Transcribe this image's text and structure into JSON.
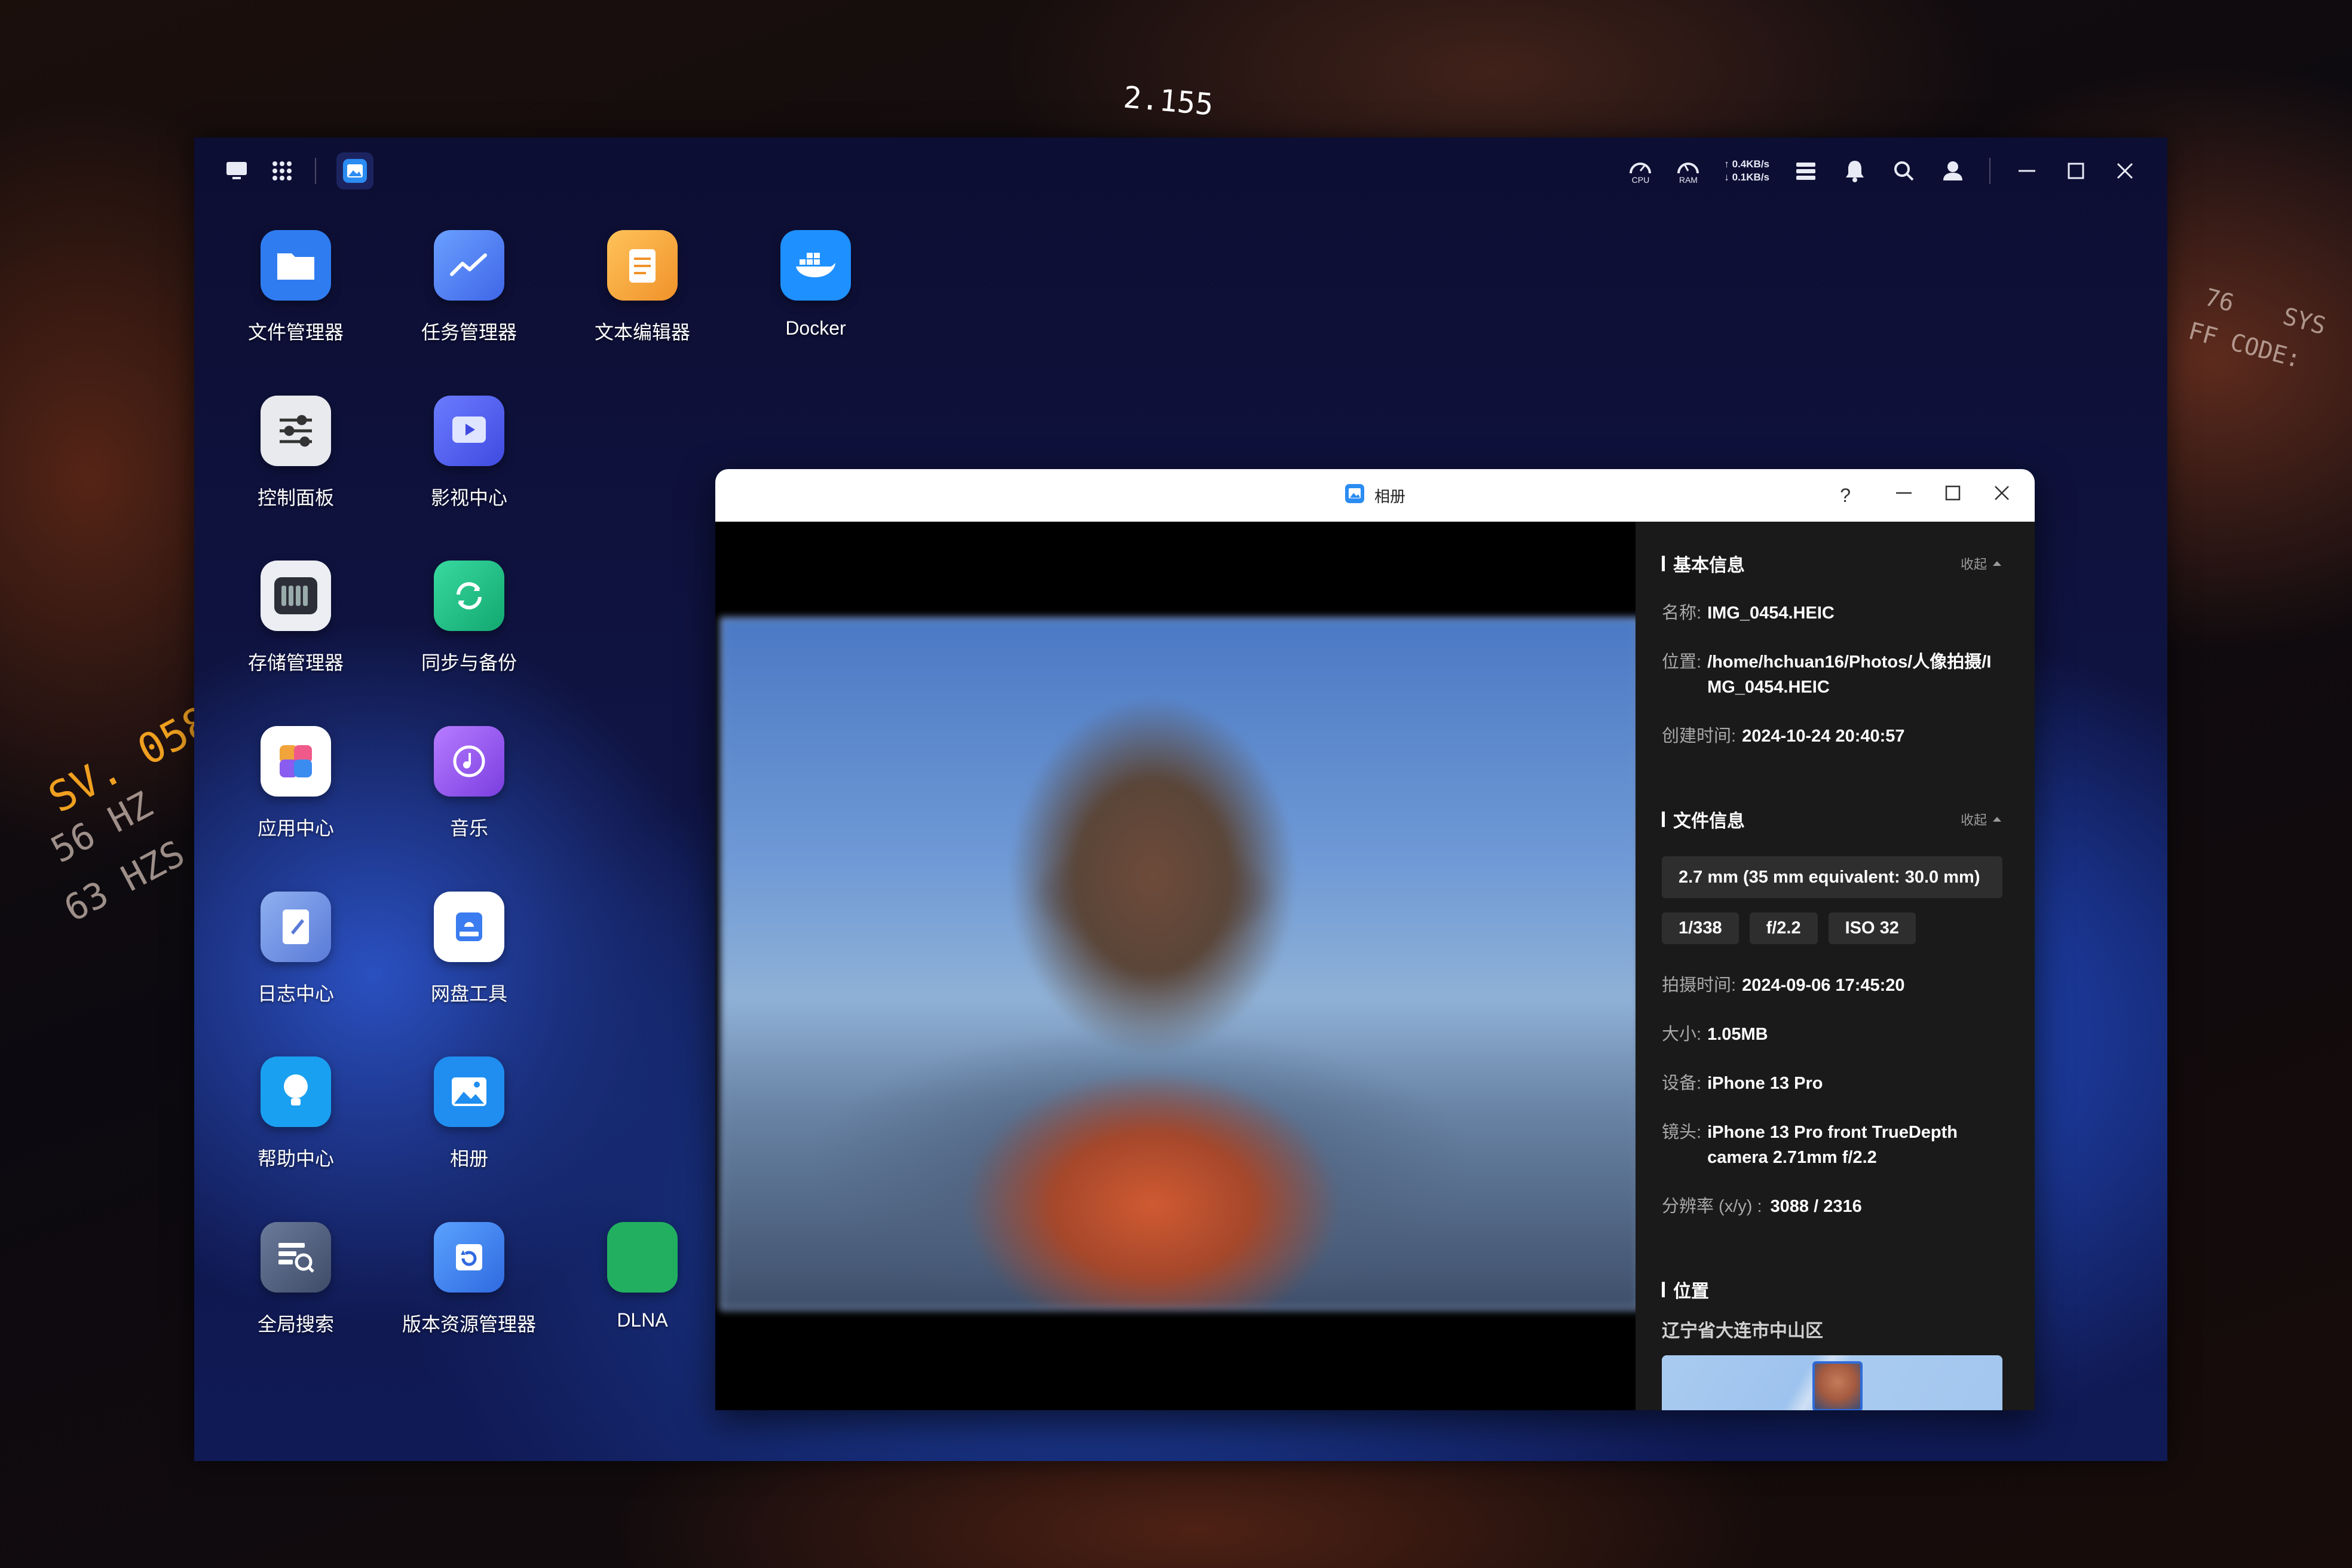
{
  "wallpaper": {
    "deco_texts": [
      "2.155",
      "SV. 058",
      "56 HZ",
      "63 HZS",
      "76",
      "SYS",
      "FF CODE:"
    ]
  },
  "topbar": {
    "left_icons": [
      "desktop-icon",
      "app-grid-icon",
      "album-app-icon"
    ],
    "meters": [
      {
        "label": "CPU"
      },
      {
        "label": "RAM"
      }
    ],
    "net": {
      "up": "↑ 0.4KB/s",
      "down": "↓ 0.1KB/s"
    },
    "right_icons": [
      "widgets-icon",
      "bell-icon",
      "search-icon",
      "user-icon",
      "minimize-icon",
      "maximize-icon",
      "close-icon"
    ]
  },
  "apps": [
    {
      "label": "文件管理器",
      "icon": "folder-icon",
      "color": "#2f7cf0"
    },
    {
      "label": "任务管理器",
      "icon": "chart-icon",
      "color": "#4f7ff0"
    },
    {
      "label": "文本编辑器",
      "icon": "notepad-icon",
      "color": "#f4a63a"
    },
    {
      "label": "Docker",
      "icon": "docker-icon",
      "color": "#1e90ff"
    },
    {
      "label": "控制面板",
      "icon": "sliders-icon",
      "color": "#e9eaee"
    },
    {
      "label": "影视中心",
      "icon": "play-icon",
      "color": "#4b5cf0"
    },
    {
      "label": "存储管理器",
      "icon": "storage-icon",
      "color": "#2d2f38"
    },
    {
      "label": "同步与备份",
      "icon": "sync-icon",
      "color": "#1fc38a"
    },
    {
      "label": "应用中心",
      "icon": "app-center-icon",
      "color": "#ffffff"
    },
    {
      "label": "音乐",
      "icon": "music-icon",
      "color": "#9b5cf0"
    },
    {
      "label": "日志中心",
      "icon": "log-icon",
      "color": "#6a8fe0"
    },
    {
      "label": "网盘工具",
      "icon": "cloud-disk-icon",
      "color": "#3b7cf0"
    },
    {
      "label": "帮助中心",
      "icon": "bulb-icon",
      "color": "#1aa0f0"
    },
    {
      "label": "相册",
      "icon": "photo-icon",
      "color": "#1f8ef0"
    },
    {
      "label": "全局搜索",
      "icon": "global-search-icon",
      "color": "#5a6a8a"
    },
    {
      "label": "版本资源管理器",
      "icon": "version-icon",
      "color": "#2f7cf0"
    },
    {
      "label": "DLNA",
      "icon": "dlna-icon",
      "color": "#22b060"
    }
  ],
  "album_window": {
    "title": "相册",
    "help": "?",
    "sections": {
      "basic": {
        "title": "基本信息",
        "collapse": "收起",
        "name_label": "名称:",
        "name": "IMG_0454.HEIC",
        "location_label": "位置:",
        "location": "/home/hchuan16/Photos/人像拍摄/IMG_0454.HEIC",
        "created_label": "创建时间:",
        "created": "2024-10-24 20:40:57"
      },
      "file": {
        "title": "文件信息",
        "collapse": "收起",
        "focal": "2.7 mm (35 mm equivalent: 30.0 mm)",
        "tags": [
          "1/338",
          "f/2.2",
          "ISO 32"
        ],
        "shot_label": "拍摄时间:",
        "shot": "2024-09-06 17:45:20",
        "size_label": "大小:",
        "size": "1.05MB",
        "device_label": "设备:",
        "device": "iPhone 13 Pro",
        "lens_label": "镜头:",
        "lens": "iPhone 13 Pro front TrueDepth camera 2.71mm f/2.2",
        "res_label": "分辨率 (x/y) :",
        "res": "3088 / 2316"
      },
      "place": {
        "title": "位置",
        "location": "辽宁省大连市中山区"
      }
    }
  }
}
